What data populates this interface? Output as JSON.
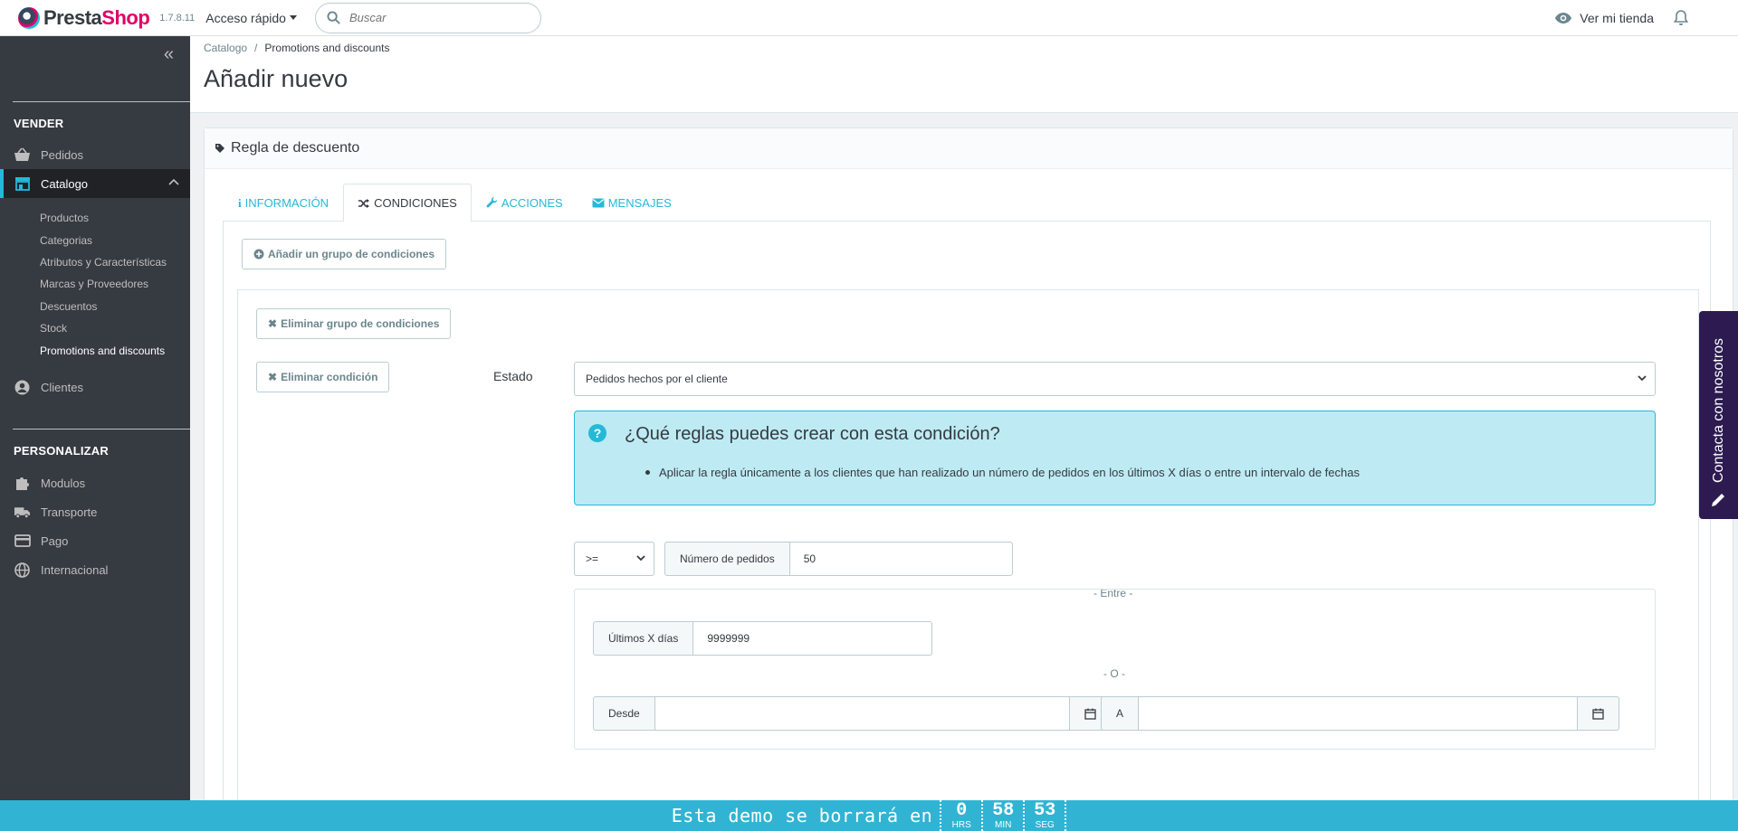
{
  "header": {
    "logo_text_1": "Presta",
    "logo_text_2": "Shop",
    "version": "1.7.8.11",
    "quick_access": "Acceso rápido",
    "search_placeholder": "Buscar",
    "view_store": "Ver mi tienda"
  },
  "sidebar": {
    "section_sell": "VENDER",
    "orders": "Pedidos",
    "catalog": "Catalogo",
    "catalog_items": [
      "Productos",
      "Categorias",
      "Atributos y Características",
      "Marcas y Proveedores",
      "Descuentos",
      "Stock",
      "Promotions and discounts"
    ],
    "customers": "Clientes",
    "section_custom": "PERSONALIZAR",
    "modules": "Modulos",
    "transport": "Transporte",
    "payment": "Pago",
    "international": "Internacional"
  },
  "breadcrumb": {
    "parent": "Catalogo",
    "separator": "/",
    "current": "Promotions and discounts"
  },
  "page_title": "Añadir nuevo",
  "panel": {
    "heading": "Regla de descuento",
    "tabs": [
      "INFORMACIÓN",
      "CONDICIONES",
      "ACCIONES",
      "MENSAJES"
    ],
    "active_tab": "CONDICIONES"
  },
  "conditions": {
    "add_group": "Añadir un grupo de condiciones",
    "remove_group": "Eliminar grupo de condiciones",
    "remove_condition": "Eliminar condición",
    "state_label": "Estado",
    "state_value": "Pedidos hechos por el cliente",
    "help_title": "¿Qué reglas puedes crear con esta condición?",
    "help_item": "Aplicar la regla únicamente a los clientes que han realizado un número de pedidos en los últimos X días o entre un intervalo de fechas",
    "operator": ">=",
    "orders_label": "Número de pedidos",
    "orders_value": "50",
    "between": "- Entre -",
    "last_days_label": "Últimos X días",
    "last_days_value": "9999999",
    "or": "- O -",
    "from_label": "Desde",
    "from_value": "",
    "to_label": "A",
    "to_value": ""
  },
  "contact_tab": "Contacta con nosotros",
  "demo_bar": {
    "text": "Esta demo se borrará en",
    "hours": "0",
    "hours_unit": "HRS",
    "minutes": "58",
    "minutes_unit": "MIN",
    "seconds": "53",
    "seconds_unit": "SEG"
  },
  "colors": {
    "accent": "#25b9d7",
    "brand_pink": "#df0067",
    "sidebar": "#363a41",
    "demo_bar": "#31b4d4",
    "contact": "#2c1a50"
  }
}
